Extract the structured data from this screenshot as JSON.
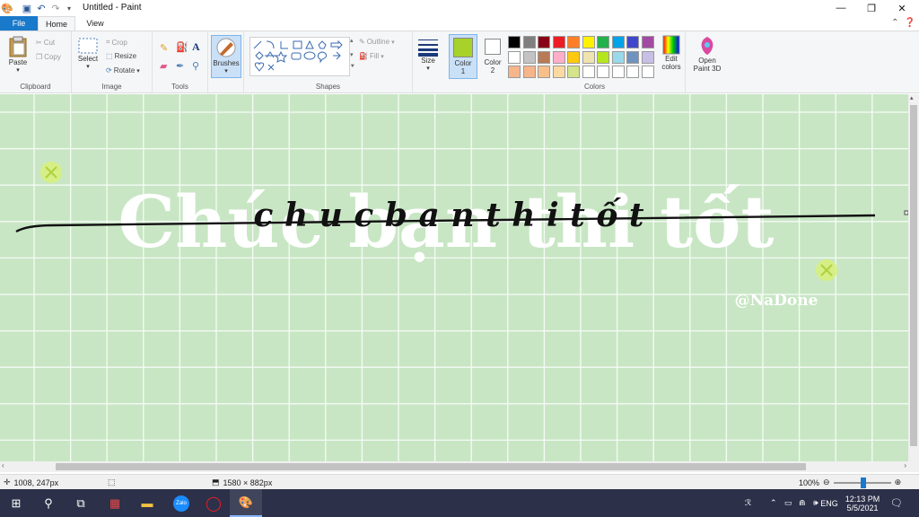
{
  "window": {
    "title": "Untitled - Paint",
    "controls": {
      "minimize": "—",
      "restore": "❐",
      "close": "✕"
    }
  },
  "tabs": {
    "file": "File",
    "home": "Home",
    "view": "View"
  },
  "ribbon": {
    "clipboard": {
      "label": "Clipboard",
      "paste": "Paste",
      "cut": "Cut",
      "copy": "Copy"
    },
    "image": {
      "label": "Image",
      "select": "Select",
      "crop": "Crop",
      "resize": "Resize",
      "rotate": "Rotate"
    },
    "tools": {
      "label": "Tools"
    },
    "brushes": {
      "label": "Brushes"
    },
    "shapes": {
      "label": "Shapes",
      "outline": "Outline",
      "fill": "Fill"
    },
    "size": {
      "label": "Size"
    },
    "color1": {
      "label": "Color",
      "num": "1",
      "value": "#a8d12a"
    },
    "color2": {
      "label": "Color",
      "num": "2",
      "value": "#ffffff"
    },
    "colors": {
      "label": "Colors",
      "palette_row1": [
        "#000000",
        "#7f7f7f",
        "#880015",
        "#ed1c24",
        "#ff7f27",
        "#fff200",
        "#22b14c",
        "#00a2e8",
        "#3f48cc",
        "#a349a4"
      ],
      "palette_row2": [
        "#ffffff",
        "#c3c3c3",
        "#b97a57",
        "#ffaec9",
        "#ffc90e",
        "#efe4b0",
        "#b5e61d",
        "#99d9ea",
        "#7092be",
        "#c8bfe7"
      ],
      "palette_row3": [
        "#f7b58a",
        "#f7b58a",
        "#f7c08a",
        "#fbd9a0",
        "#d4e48a",
        "#ffffff",
        "#ffffff",
        "#ffffff",
        "#ffffff",
        "#ffffff"
      ],
      "edit_colors": "Edit colors",
      "open_paint3d": "Open Paint 3D"
    }
  },
  "canvas": {
    "background": "#c8e6c4",
    "big_text": "Chúc bạn thi tốt",
    "script_text": "c h u c   b a n   t h i   t ố t",
    "watermark": "@NaDone"
  },
  "status": {
    "cursor_pos": "1008, 247px",
    "image_size": "1580 × 882px",
    "zoom": "100%"
  },
  "taskbar": {
    "lang": "ENG",
    "time": "12:13 PM",
    "date": "5/5/2021"
  }
}
